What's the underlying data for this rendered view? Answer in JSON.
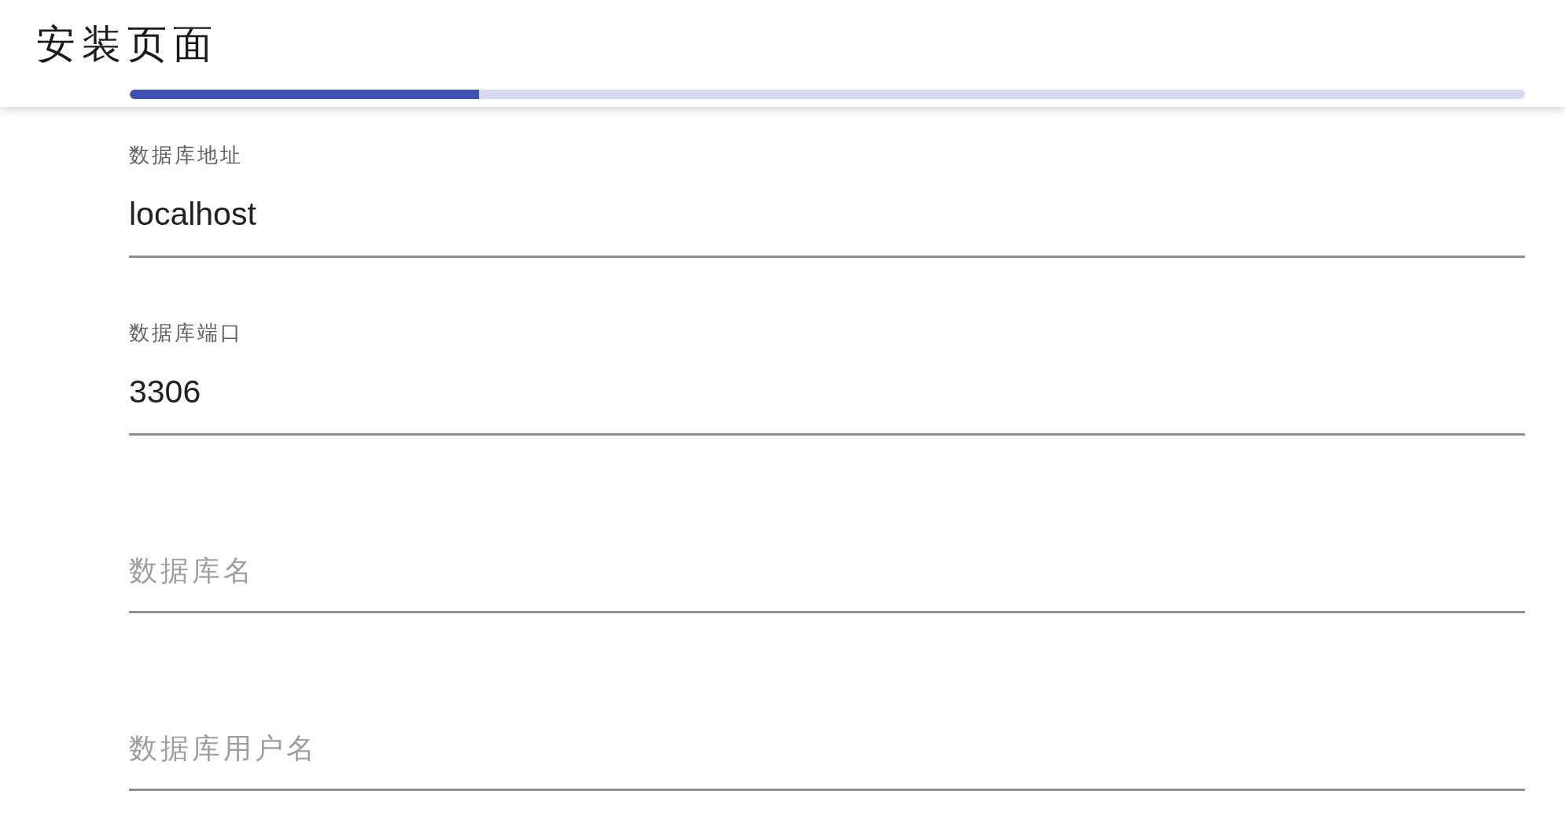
{
  "page": {
    "title": "安装页面"
  },
  "progress": {
    "level": 0.25
  },
  "fields": [
    {
      "label": "数据库地址",
      "value": "localhost"
    },
    {
      "label": "数据库端口",
      "value": "3306"
    },
    {
      "placeholder": "数据库名"
    },
    {
      "placeholder": "数据库用户名"
    }
  ]
}
